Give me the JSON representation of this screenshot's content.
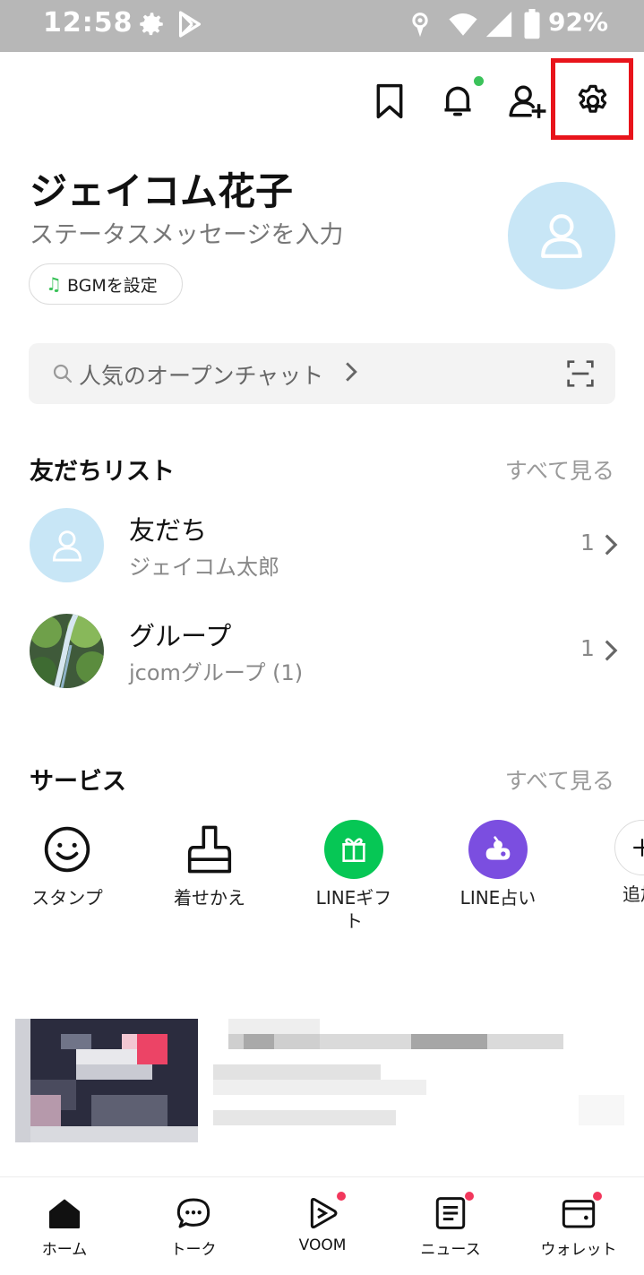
{
  "status_bar": {
    "time": "12:58",
    "battery": "92%"
  },
  "profile": {
    "name": "ジェイコム花子",
    "status_placeholder": "ステータスメッセージを入力",
    "bgm_button": "BGMを設定"
  },
  "search": {
    "label": "人気のオープンチャット"
  },
  "friends_section": {
    "title": "友だちリスト",
    "see_all": "すべて見る",
    "rows": [
      {
        "title": "友だち",
        "subtitle": "ジェイコム太郎",
        "count": "1"
      },
      {
        "title": "グループ",
        "subtitle": "jcomグループ (1)",
        "count": "1"
      }
    ]
  },
  "services_section": {
    "title": "サービス",
    "see_all": "すべて見る",
    "items": [
      {
        "label": "スタンプ",
        "icon": "smiley-icon"
      },
      {
        "label": "着せかえ",
        "icon": "brush-icon"
      },
      {
        "label": "LINEギフト",
        "icon": "gift-icon"
      },
      {
        "label": "LINE占い",
        "icon": "fortune-icon"
      },
      {
        "label": "追加",
        "icon": "plus-icon"
      }
    ]
  },
  "bottom_nav": [
    {
      "label": "ホーム",
      "icon": "home-icon"
    },
    {
      "label": "トーク",
      "icon": "chat-icon"
    },
    {
      "label": "VOOM",
      "icon": "voom-icon"
    },
    {
      "label": "ニュース",
      "icon": "news-icon"
    },
    {
      "label": "ウォレット",
      "icon": "wallet-icon"
    }
  ],
  "colors": {
    "highlight": "#e8141b",
    "online_dot": "#3bc25a",
    "badge_dot": "#f2375c",
    "gift_green": "#06c755",
    "fortune_purple": "#7b4ee0",
    "avatar_blue": "#c8e6f6"
  }
}
